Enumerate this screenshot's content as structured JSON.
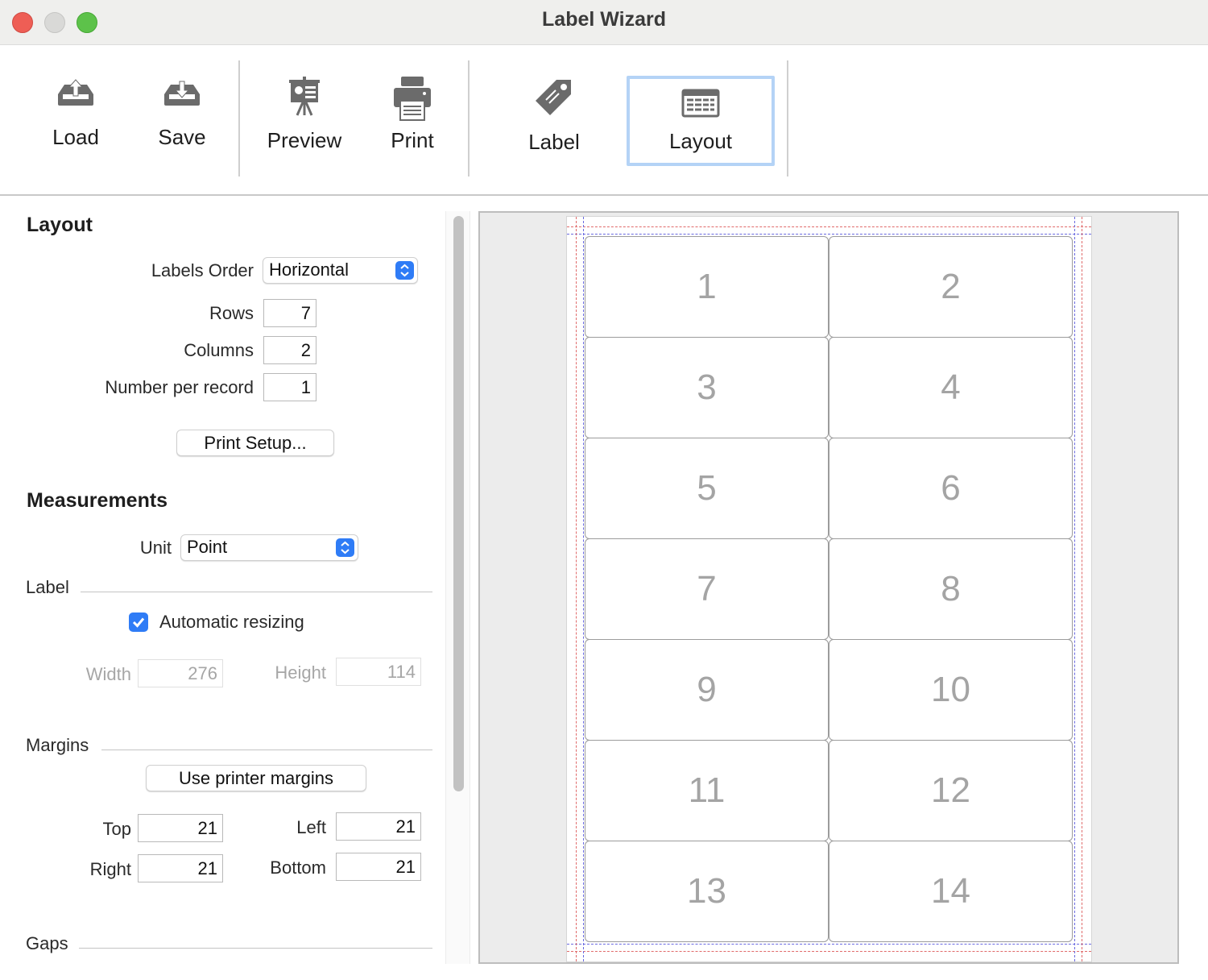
{
  "window": {
    "title": "Label Wizard"
  },
  "toolbar": {
    "load": "Load",
    "save": "Save",
    "preview": "Preview",
    "print": "Print",
    "label": "Label",
    "layout": "Layout",
    "selected": "Layout"
  },
  "layout_section": {
    "title": "Layout",
    "labels_order_label": "Labels Order",
    "labels_order_value": "Horizontal",
    "rows_label": "Rows",
    "rows_value": "7",
    "columns_label": "Columns",
    "columns_value": "2",
    "number_per_record_label": "Number per record",
    "number_per_record_value": "1",
    "print_setup_button": "Print Setup..."
  },
  "measurements": {
    "title": "Measurements",
    "unit_label": "Unit",
    "unit_value": "Point",
    "label_group": "Label",
    "automatic_resizing_label": "Automatic resizing",
    "automatic_resizing_checked": true,
    "width_label": "Width",
    "width_value": "276",
    "height_label": "Height",
    "height_value": "114",
    "margins_group": "Margins",
    "use_printer_margins_button": "Use printer margins",
    "top_label": "Top",
    "top_value": "21",
    "left_label": "Left",
    "left_value": "21",
    "right_label": "Right",
    "right_value": "21",
    "bottom_label": "Bottom",
    "bottom_value": "21",
    "gaps_group": "Gaps"
  },
  "preview": {
    "labels": [
      "1",
      "2",
      "3",
      "4",
      "5",
      "6",
      "7",
      "8",
      "9",
      "10",
      "11",
      "12",
      "13",
      "14"
    ]
  },
  "colors": {
    "accent": "#2f7cf6",
    "selected_border": "#b4d3f6",
    "guide_red": "#e06a6a",
    "guide_blue": "#6a6ae0"
  }
}
